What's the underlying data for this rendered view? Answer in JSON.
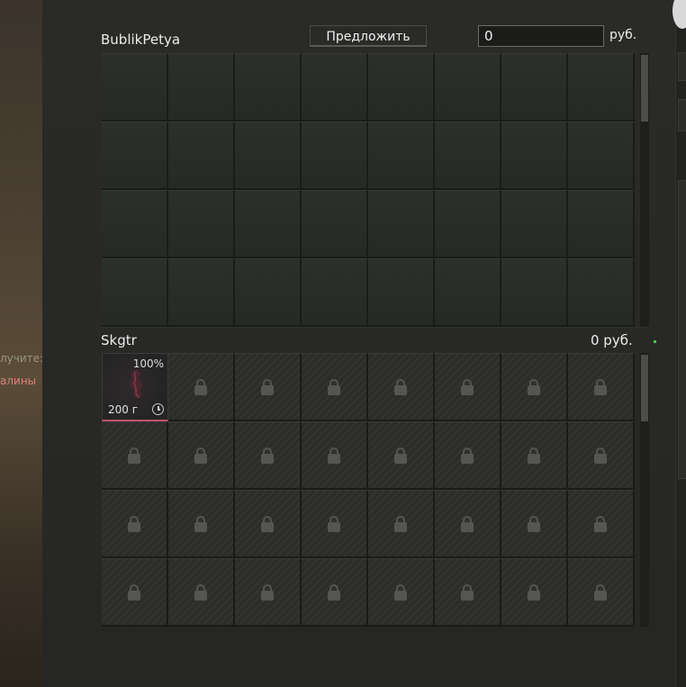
{
  "side": {
    "receive_label": "лучите:",
    "item_label": "алины"
  },
  "partner": {
    "name": "BublikPetya",
    "offer_button": "Предложить",
    "money_value": "0",
    "currency": "руб."
  },
  "player": {
    "name": "Skgtr",
    "money_total": "0 руб.",
    "item": {
      "durability": "100%",
      "weight": "200 г",
      "icon": "timer-icon",
      "rarity_color": "#c0506a"
    }
  },
  "colors": {
    "panel_bg": "#262624",
    "empty_cell": "#2a2f2a",
    "locked_cell": "#2c2c2b",
    "accent_green": "#3cd24a"
  }
}
